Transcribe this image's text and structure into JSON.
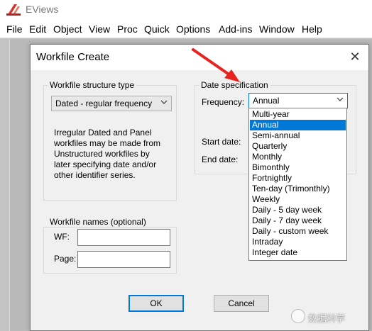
{
  "app": {
    "title": "EViews",
    "logo_icon": "eviews-logo-icon",
    "brand_color": "#d8312b"
  },
  "menubar": {
    "items": [
      "File",
      "Edit",
      "Object",
      "View",
      "Proc",
      "Quick",
      "Options",
      "Add-ins",
      "Window",
      "Help"
    ]
  },
  "dialog": {
    "title": "Workfile Create",
    "close_icon": "close-icon",
    "structure": {
      "group_label": "Workfile structure type",
      "selected": "Dated - regular frequency",
      "info_lines": [
        "Irregular Dated and Panel",
        "workfiles may be made from",
        "Unstructured workfiles by",
        "later specifying date and/or",
        "other identifier series."
      ]
    },
    "date_spec": {
      "group_label": "Date specification",
      "frequency_label": "Frequency:",
      "frequency_value": "Annual",
      "start_label": "Start date:",
      "end_label": "End date:",
      "options": [
        "Multi-year",
        "Annual",
        "Semi-annual",
        "Quarterly",
        "Monthly",
        "Bimonthly",
        "Fortnightly",
        "Ten-day (Trimonthly)",
        "Weekly",
        "Daily - 5 day week",
        "Daily - 7 day week",
        "Daily - custom week",
        "Intraday",
        "Integer date"
      ],
      "selected_option": "Annual"
    },
    "names": {
      "group_label": "Workfile names (optional)",
      "wf_label": "WF:",
      "page_label": "Page:",
      "wf_value": "",
      "page_value": ""
    },
    "buttons": {
      "ok": "OK",
      "cancel": "Cancel"
    }
  },
  "annotation": {
    "arrow_color": "#e8231f"
  },
  "watermark": {
    "text": "数据科学"
  },
  "colors": {
    "selection": "#0078d7",
    "dialog_bg": "#f0f0f0"
  }
}
